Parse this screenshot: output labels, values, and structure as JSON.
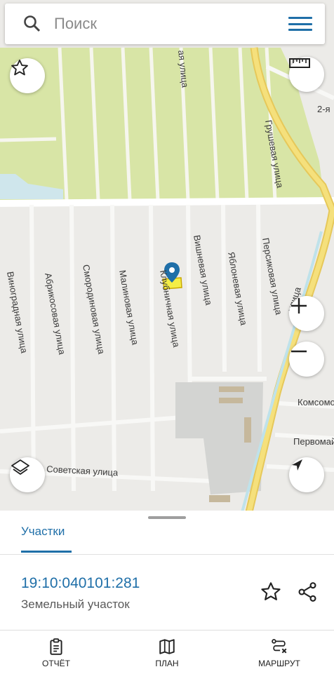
{
  "search": {
    "placeholder": "Поиск"
  },
  "map": {
    "streets": {
      "vinogradnaya": "Виноградная улица",
      "abrikosovaya": "Абрикосовая улица",
      "smorodinovaya": "Смородиновая улица",
      "malinovaya": "Малиновая улица",
      "klubnichnaya": "Клубничная улица",
      "vishnevaya": "Вишневая улица",
      "yablonevaya": "Яблоневая улица",
      "persikovaya": "Персиковая улица",
      "grushevaya": "Грушевая улица",
      "sovetskaya": "Советская улица",
      "komsomo": "Комсомо",
      "pervomay": "Первомай",
      "second": "2-я",
      "top_partial": "ая улица",
      "right_partial": "улица"
    }
  },
  "sheet": {
    "tab_label": "Участки",
    "cadastral_number": "19:10:040101:281",
    "parcel_type": "Земельный участок"
  },
  "bottom_nav": {
    "report": "ОТЧЁТ",
    "plan": "ПЛАН",
    "route": "МАРШРУТ"
  },
  "colors": {
    "accent": "#1f6fa8",
    "garden_green": "#d9e6a8",
    "road_yellow": "#f2dc72"
  }
}
